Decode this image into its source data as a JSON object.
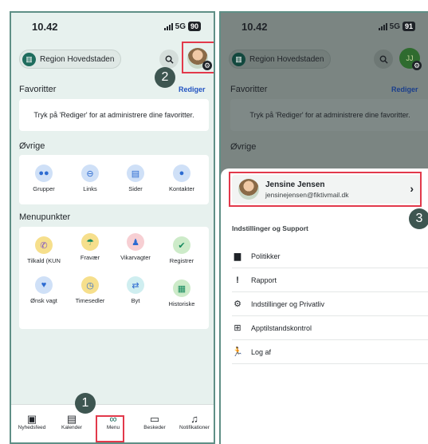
{
  "left": {
    "status": {
      "time": "10.42",
      "network": "5G",
      "battery": "90"
    },
    "region_label": "Region Hovedstaden",
    "favorites": {
      "title": "Favoritter",
      "edit": "Rediger",
      "hint": "Tryk på 'Rediger' for at administrere dine favoritter."
    },
    "other": {
      "title": "Øvrige",
      "items": [
        {
          "label": "Grupper",
          "icon": "users-icon",
          "color": "#cfe0f7"
        },
        {
          "label": "Links",
          "icon": "link-icon",
          "color": "#cfe0f7"
        },
        {
          "label": "Sider",
          "icon": "page-icon",
          "color": "#cfe0f7"
        },
        {
          "label": "Kontakter",
          "icon": "contact-icon",
          "color": "#cfe0f7"
        }
      ]
    },
    "menu": {
      "title": "Menupunkter",
      "items": [
        {
          "label": "Tilkald (KUN",
          "icon": "phone-call-icon",
          "color": "#f6df8c"
        },
        {
          "label": "Fravær",
          "icon": "beach-icon",
          "color": "#f6df8c"
        },
        {
          "label": "Vikarvagter",
          "icon": "staff-icon",
          "color": "#f7cfd3"
        },
        {
          "label": "Registrer",
          "icon": "check-icon",
          "color": "#cdebc9"
        },
        {
          "label": "Ønsk vagt",
          "icon": "heart-icon",
          "color": "#cfe0f7"
        },
        {
          "label": "Timesedler",
          "icon": "timesheet-icon",
          "color": "#f6df8c"
        },
        {
          "label": "Byt",
          "icon": "swap-icon",
          "color": "#cfeef0"
        },
        {
          "label": "Historiske",
          "icon": "history-doc-icon",
          "color": "#cdebc9"
        }
      ]
    },
    "nav": [
      {
        "label": "Nyhedsfeed",
        "icon": "newsfeed-icon"
      },
      {
        "label": "Kalender",
        "icon": "calendar-icon"
      },
      {
        "label": "Menu",
        "icon": "menu-icon"
      },
      {
        "label": "Beskeder",
        "icon": "messages-icon"
      },
      {
        "label": "Notifikationer",
        "icon": "bell-icon"
      }
    ],
    "steps": [
      "2",
      "1"
    ]
  },
  "right": {
    "status": {
      "time": "10.42",
      "network": "5G",
      "battery": "91"
    },
    "region_label": "Region Hovedstaden",
    "avatar_initials": "JJ",
    "favorites": {
      "title": "Favoritter",
      "edit": "Rediger",
      "hint": "Tryk på 'Rediger' for at administrere dine favoritter."
    },
    "other_title": "Øvrige",
    "user": {
      "name": "Jensine Jensen",
      "email": "jensinejensen@fiktivmail.dk"
    },
    "section_title": "Indstillinger og Support",
    "menu": [
      {
        "label": "Politikker",
        "icon": "book-icon"
      },
      {
        "label": "Rapport",
        "icon": "exclamation-icon"
      },
      {
        "label": "Indstillinger og Privatliv",
        "icon": "gear-icon"
      },
      {
        "label": "Apptilstandskontrol",
        "icon": "plus-box-icon"
      },
      {
        "label": "Log af",
        "icon": "logout-runner-icon"
      }
    ],
    "step": "3"
  }
}
